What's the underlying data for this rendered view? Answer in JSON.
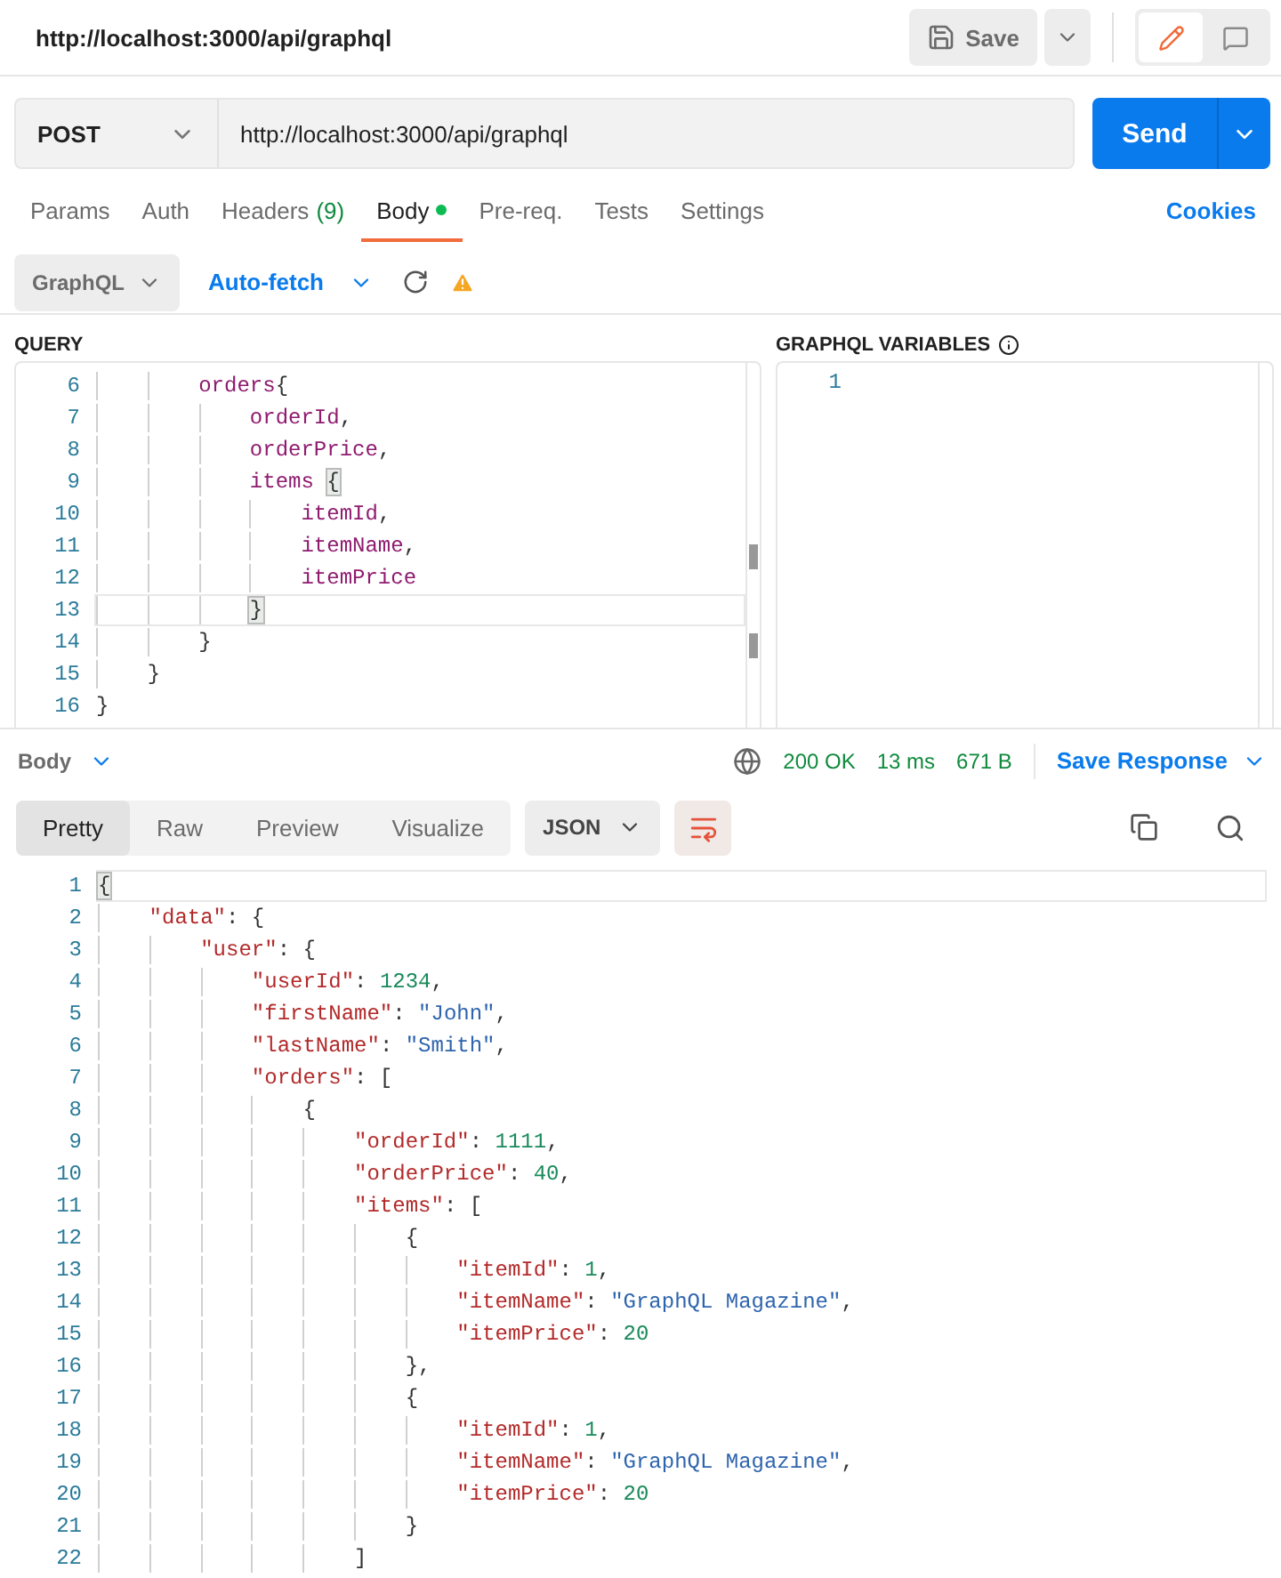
{
  "header": {
    "title": "http://localhost:3000/api/graphql",
    "save": "Save",
    "view_toggle": [
      {
        "kind": "edit",
        "selected": true
      },
      {
        "kind": "comment",
        "selected": false
      }
    ]
  },
  "request": {
    "method": "POST",
    "url": "http://localhost:3000/api/graphql",
    "send": "Send"
  },
  "tabs": [
    {
      "label": "Params",
      "selected": false,
      "indicator": false
    },
    {
      "label": "Auth",
      "selected": false,
      "indicator": false
    },
    {
      "label": "Headers",
      "count": "(9)",
      "selected": false,
      "indicator": false
    },
    {
      "label": "Body",
      "selected": true,
      "indicator": true
    },
    {
      "label": "Pre-req.",
      "selected": false,
      "indicator": false
    },
    {
      "label": "Tests",
      "selected": false,
      "indicator": false
    },
    {
      "label": "Settings",
      "selected": false,
      "indicator": false
    }
  ],
  "cookies": "Cookies",
  "body_mode": {
    "mode": "GraphQL",
    "auto_fetch": "Auto-fetch"
  },
  "query": {
    "label": "QUERY",
    "lines": [
      {
        "number": "6",
        "active": false,
        "tokens": [
          {
            "kind": "field",
            "text": "        orders"
          },
          {
            "kind": "brace",
            "text": "{",
            "matched": false
          }
        ]
      },
      {
        "number": "7",
        "active": false,
        "tokens": [
          {
            "kind": "field",
            "text": "            orderId"
          },
          {
            "kind": "punct",
            "text": ","
          }
        ]
      },
      {
        "number": "8",
        "active": false,
        "tokens": [
          {
            "kind": "field",
            "text": "            orderPrice"
          },
          {
            "kind": "punct",
            "text": ","
          }
        ]
      },
      {
        "number": "9",
        "active": false,
        "tokens": [
          {
            "kind": "field",
            "text": "            items "
          },
          {
            "kind": "brace",
            "text": "{",
            "matched": true
          }
        ]
      },
      {
        "number": "10",
        "active": false,
        "tokens": [
          {
            "kind": "field",
            "text": "                itemId"
          },
          {
            "kind": "punct",
            "text": ","
          }
        ]
      },
      {
        "number": "11",
        "active": false,
        "tokens": [
          {
            "kind": "field",
            "text": "                itemName"
          },
          {
            "kind": "punct",
            "text": ","
          }
        ]
      },
      {
        "number": "12",
        "active": false,
        "tokens": [
          {
            "kind": "field",
            "text": "                itemPrice"
          }
        ]
      },
      {
        "number": "13",
        "active": true,
        "tokens": [
          {
            "kind": "brace",
            "text": "            }",
            "matched": true
          }
        ]
      },
      {
        "number": "14",
        "active": false,
        "tokens": [
          {
            "kind": "brace",
            "text": "        }",
            "matched": false
          }
        ]
      },
      {
        "number": "15",
        "active": false,
        "tokens": [
          {
            "kind": "brace",
            "text": "    }",
            "matched": false
          }
        ]
      },
      {
        "number": "16",
        "active": false,
        "tokens": [
          {
            "kind": "brace",
            "text": "}",
            "matched": false
          }
        ]
      }
    ]
  },
  "variables": {
    "label": "GRAPHQL VARIABLES",
    "lines": [
      {
        "number": "1",
        "active": false
      }
    ]
  },
  "response": {
    "section": "Body",
    "status": "200 OK",
    "time": "13 ms",
    "size": "671 B",
    "save": "Save Response",
    "views": [
      {
        "label": "Pretty",
        "selected": true
      },
      {
        "label": "Raw",
        "selected": false
      },
      {
        "label": "Preview",
        "selected": false
      },
      {
        "label": "Visualize",
        "selected": false
      }
    ],
    "format": "JSON",
    "wrap": true,
    "lines": [
      {
        "number": "1",
        "active": true,
        "tokens": [
          {
            "kind": "brace",
            "text": "{",
            "matched": true
          }
        ]
      },
      {
        "number": "2",
        "active": false,
        "tokens": [
          {
            "kind": "key",
            "text": "    \"data\""
          },
          {
            "kind": "punct",
            "text": ": "
          },
          {
            "kind": "brace",
            "text": "{",
            "matched": false
          }
        ]
      },
      {
        "number": "3",
        "active": false,
        "tokens": [
          {
            "kind": "key",
            "text": "        \"user\""
          },
          {
            "kind": "punct",
            "text": ": "
          },
          {
            "kind": "brace",
            "text": "{",
            "matched": false
          }
        ]
      },
      {
        "number": "4",
        "active": false,
        "tokens": [
          {
            "kind": "key",
            "text": "            \"userId\""
          },
          {
            "kind": "punct",
            "text": ": "
          },
          {
            "kind": "number",
            "text": "1234"
          },
          {
            "kind": "punct",
            "text": ","
          }
        ]
      },
      {
        "number": "5",
        "active": false,
        "tokens": [
          {
            "kind": "key",
            "text": "            \"firstName\""
          },
          {
            "kind": "punct",
            "text": ": "
          },
          {
            "kind": "string",
            "text": "\"John\""
          },
          {
            "kind": "punct",
            "text": ","
          }
        ]
      },
      {
        "number": "6",
        "active": false,
        "tokens": [
          {
            "kind": "key",
            "text": "            \"lastName\""
          },
          {
            "kind": "punct",
            "text": ": "
          },
          {
            "kind": "string",
            "text": "\"Smith\""
          },
          {
            "kind": "punct",
            "text": ","
          }
        ]
      },
      {
        "number": "7",
        "active": false,
        "tokens": [
          {
            "kind": "key",
            "text": "            \"orders\""
          },
          {
            "kind": "punct",
            "text": ": ["
          }
        ]
      },
      {
        "number": "8",
        "active": false,
        "tokens": [
          {
            "kind": "brace",
            "text": "                {",
            "matched": false
          }
        ]
      },
      {
        "number": "9",
        "active": false,
        "tokens": [
          {
            "kind": "key",
            "text": "                    \"orderId\""
          },
          {
            "kind": "punct",
            "text": ": "
          },
          {
            "kind": "number",
            "text": "1111"
          },
          {
            "kind": "punct",
            "text": ","
          }
        ]
      },
      {
        "number": "10",
        "active": false,
        "tokens": [
          {
            "kind": "key",
            "text": "                    \"orderPrice\""
          },
          {
            "kind": "punct",
            "text": ": "
          },
          {
            "kind": "number",
            "text": "40"
          },
          {
            "kind": "punct",
            "text": ","
          }
        ]
      },
      {
        "number": "11",
        "active": false,
        "tokens": [
          {
            "kind": "key",
            "text": "                    \"items\""
          },
          {
            "kind": "punct",
            "text": ": ["
          }
        ]
      },
      {
        "number": "12",
        "active": false,
        "tokens": [
          {
            "kind": "brace",
            "text": "                        {",
            "matched": false
          }
        ]
      },
      {
        "number": "13",
        "active": false,
        "tokens": [
          {
            "kind": "key",
            "text": "                            \"itemId\""
          },
          {
            "kind": "punct",
            "text": ": "
          },
          {
            "kind": "number",
            "text": "1"
          },
          {
            "kind": "punct",
            "text": ","
          }
        ]
      },
      {
        "number": "14",
        "active": false,
        "tokens": [
          {
            "kind": "key",
            "text": "                            \"itemName\""
          },
          {
            "kind": "punct",
            "text": ": "
          },
          {
            "kind": "string",
            "text": "\"GraphQL Magazine\""
          },
          {
            "kind": "punct",
            "text": ","
          }
        ]
      },
      {
        "number": "15",
        "active": false,
        "tokens": [
          {
            "kind": "key",
            "text": "                            \"itemPrice\""
          },
          {
            "kind": "punct",
            "text": ": "
          },
          {
            "kind": "number",
            "text": "20"
          }
        ]
      },
      {
        "number": "16",
        "active": false,
        "tokens": [
          {
            "kind": "brace",
            "text": "                        }",
            "matched": false
          },
          {
            "kind": "punct",
            "text": ","
          }
        ]
      },
      {
        "number": "17",
        "active": false,
        "tokens": [
          {
            "kind": "brace",
            "text": "                        {",
            "matched": false
          }
        ]
      },
      {
        "number": "18",
        "active": false,
        "tokens": [
          {
            "kind": "key",
            "text": "                            \"itemId\""
          },
          {
            "kind": "punct",
            "text": ": "
          },
          {
            "kind": "number",
            "text": "1"
          },
          {
            "kind": "punct",
            "text": ","
          }
        ]
      },
      {
        "number": "19",
        "active": false,
        "tokens": [
          {
            "kind": "key",
            "text": "                            \"itemName\""
          },
          {
            "kind": "punct",
            "text": ": "
          },
          {
            "kind": "string",
            "text": "\"GraphQL Magazine\""
          },
          {
            "kind": "punct",
            "text": ","
          }
        ]
      },
      {
        "number": "20",
        "active": false,
        "tokens": [
          {
            "kind": "key",
            "text": "                            \"itemPrice\""
          },
          {
            "kind": "punct",
            "text": ": "
          },
          {
            "kind": "number",
            "text": "20"
          }
        ]
      },
      {
        "number": "21",
        "active": false,
        "tokens": [
          {
            "kind": "brace",
            "text": "                        }",
            "matched": false
          }
        ]
      },
      {
        "number": "22",
        "active": false,
        "tokens": [
          {
            "kind": "punct",
            "text": "                    ]"
          }
        ]
      }
    ]
  }
}
